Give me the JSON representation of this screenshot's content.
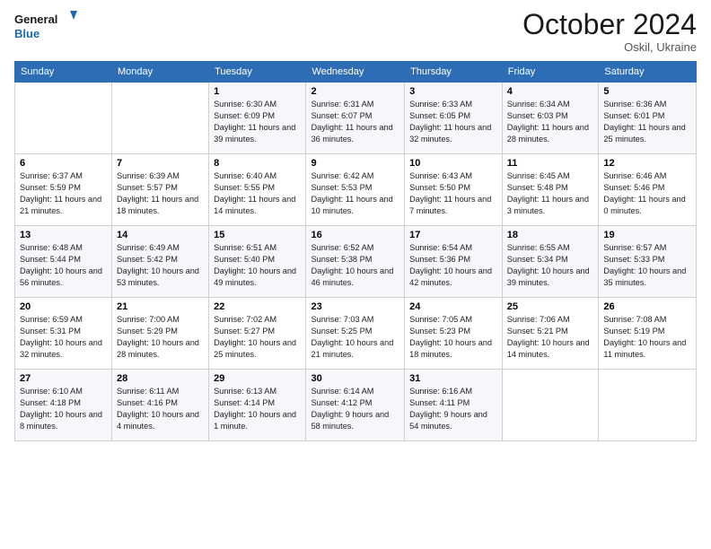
{
  "header": {
    "logo_line1": "General",
    "logo_line2": "Blue",
    "month": "October 2024",
    "location": "Oskil, Ukraine"
  },
  "columns": [
    "Sunday",
    "Monday",
    "Tuesday",
    "Wednesday",
    "Thursday",
    "Friday",
    "Saturday"
  ],
  "weeks": [
    [
      {
        "day": "",
        "sunrise": "",
        "sunset": "",
        "daylight": ""
      },
      {
        "day": "",
        "sunrise": "",
        "sunset": "",
        "daylight": ""
      },
      {
        "day": "1",
        "sunrise": "Sunrise: 6:30 AM",
        "sunset": "Sunset: 6:09 PM",
        "daylight": "Daylight: 11 hours and 39 minutes."
      },
      {
        "day": "2",
        "sunrise": "Sunrise: 6:31 AM",
        "sunset": "Sunset: 6:07 PM",
        "daylight": "Daylight: 11 hours and 36 minutes."
      },
      {
        "day": "3",
        "sunrise": "Sunrise: 6:33 AM",
        "sunset": "Sunset: 6:05 PM",
        "daylight": "Daylight: 11 hours and 32 minutes."
      },
      {
        "day": "4",
        "sunrise": "Sunrise: 6:34 AM",
        "sunset": "Sunset: 6:03 PM",
        "daylight": "Daylight: 11 hours and 28 minutes."
      },
      {
        "day": "5",
        "sunrise": "Sunrise: 6:36 AM",
        "sunset": "Sunset: 6:01 PM",
        "daylight": "Daylight: 11 hours and 25 minutes."
      }
    ],
    [
      {
        "day": "6",
        "sunrise": "Sunrise: 6:37 AM",
        "sunset": "Sunset: 5:59 PM",
        "daylight": "Daylight: 11 hours and 21 minutes."
      },
      {
        "day": "7",
        "sunrise": "Sunrise: 6:39 AM",
        "sunset": "Sunset: 5:57 PM",
        "daylight": "Daylight: 11 hours and 18 minutes."
      },
      {
        "day": "8",
        "sunrise": "Sunrise: 6:40 AM",
        "sunset": "Sunset: 5:55 PM",
        "daylight": "Daylight: 11 hours and 14 minutes."
      },
      {
        "day": "9",
        "sunrise": "Sunrise: 6:42 AM",
        "sunset": "Sunset: 5:53 PM",
        "daylight": "Daylight: 11 hours and 10 minutes."
      },
      {
        "day": "10",
        "sunrise": "Sunrise: 6:43 AM",
        "sunset": "Sunset: 5:50 PM",
        "daylight": "Daylight: 11 hours and 7 minutes."
      },
      {
        "day": "11",
        "sunrise": "Sunrise: 6:45 AM",
        "sunset": "Sunset: 5:48 PM",
        "daylight": "Daylight: 11 hours and 3 minutes."
      },
      {
        "day": "12",
        "sunrise": "Sunrise: 6:46 AM",
        "sunset": "Sunset: 5:46 PM",
        "daylight": "Daylight: 11 hours and 0 minutes."
      }
    ],
    [
      {
        "day": "13",
        "sunrise": "Sunrise: 6:48 AM",
        "sunset": "Sunset: 5:44 PM",
        "daylight": "Daylight: 10 hours and 56 minutes."
      },
      {
        "day": "14",
        "sunrise": "Sunrise: 6:49 AM",
        "sunset": "Sunset: 5:42 PM",
        "daylight": "Daylight: 10 hours and 53 minutes."
      },
      {
        "day": "15",
        "sunrise": "Sunrise: 6:51 AM",
        "sunset": "Sunset: 5:40 PM",
        "daylight": "Daylight: 10 hours and 49 minutes."
      },
      {
        "day": "16",
        "sunrise": "Sunrise: 6:52 AM",
        "sunset": "Sunset: 5:38 PM",
        "daylight": "Daylight: 10 hours and 46 minutes."
      },
      {
        "day": "17",
        "sunrise": "Sunrise: 6:54 AM",
        "sunset": "Sunset: 5:36 PM",
        "daylight": "Daylight: 10 hours and 42 minutes."
      },
      {
        "day": "18",
        "sunrise": "Sunrise: 6:55 AM",
        "sunset": "Sunset: 5:34 PM",
        "daylight": "Daylight: 10 hours and 39 minutes."
      },
      {
        "day": "19",
        "sunrise": "Sunrise: 6:57 AM",
        "sunset": "Sunset: 5:33 PM",
        "daylight": "Daylight: 10 hours and 35 minutes."
      }
    ],
    [
      {
        "day": "20",
        "sunrise": "Sunrise: 6:59 AM",
        "sunset": "Sunset: 5:31 PM",
        "daylight": "Daylight: 10 hours and 32 minutes."
      },
      {
        "day": "21",
        "sunrise": "Sunrise: 7:00 AM",
        "sunset": "Sunset: 5:29 PM",
        "daylight": "Daylight: 10 hours and 28 minutes."
      },
      {
        "day": "22",
        "sunrise": "Sunrise: 7:02 AM",
        "sunset": "Sunset: 5:27 PM",
        "daylight": "Daylight: 10 hours and 25 minutes."
      },
      {
        "day": "23",
        "sunrise": "Sunrise: 7:03 AM",
        "sunset": "Sunset: 5:25 PM",
        "daylight": "Daylight: 10 hours and 21 minutes."
      },
      {
        "day": "24",
        "sunrise": "Sunrise: 7:05 AM",
        "sunset": "Sunset: 5:23 PM",
        "daylight": "Daylight: 10 hours and 18 minutes."
      },
      {
        "day": "25",
        "sunrise": "Sunrise: 7:06 AM",
        "sunset": "Sunset: 5:21 PM",
        "daylight": "Daylight: 10 hours and 14 minutes."
      },
      {
        "day": "26",
        "sunrise": "Sunrise: 7:08 AM",
        "sunset": "Sunset: 5:19 PM",
        "daylight": "Daylight: 10 hours and 11 minutes."
      }
    ],
    [
      {
        "day": "27",
        "sunrise": "Sunrise: 6:10 AM",
        "sunset": "Sunset: 4:18 PM",
        "daylight": "Daylight: 10 hours and 8 minutes."
      },
      {
        "day": "28",
        "sunrise": "Sunrise: 6:11 AM",
        "sunset": "Sunset: 4:16 PM",
        "daylight": "Daylight: 10 hours and 4 minutes."
      },
      {
        "day": "29",
        "sunrise": "Sunrise: 6:13 AM",
        "sunset": "Sunset: 4:14 PM",
        "daylight": "Daylight: 10 hours and 1 minute."
      },
      {
        "day": "30",
        "sunrise": "Sunrise: 6:14 AM",
        "sunset": "Sunset: 4:12 PM",
        "daylight": "Daylight: 9 hours and 58 minutes."
      },
      {
        "day": "31",
        "sunrise": "Sunrise: 6:16 AM",
        "sunset": "Sunset: 4:11 PM",
        "daylight": "Daylight: 9 hours and 54 minutes."
      },
      {
        "day": "",
        "sunrise": "",
        "sunset": "",
        "daylight": ""
      },
      {
        "day": "",
        "sunrise": "",
        "sunset": "",
        "daylight": ""
      }
    ]
  ]
}
